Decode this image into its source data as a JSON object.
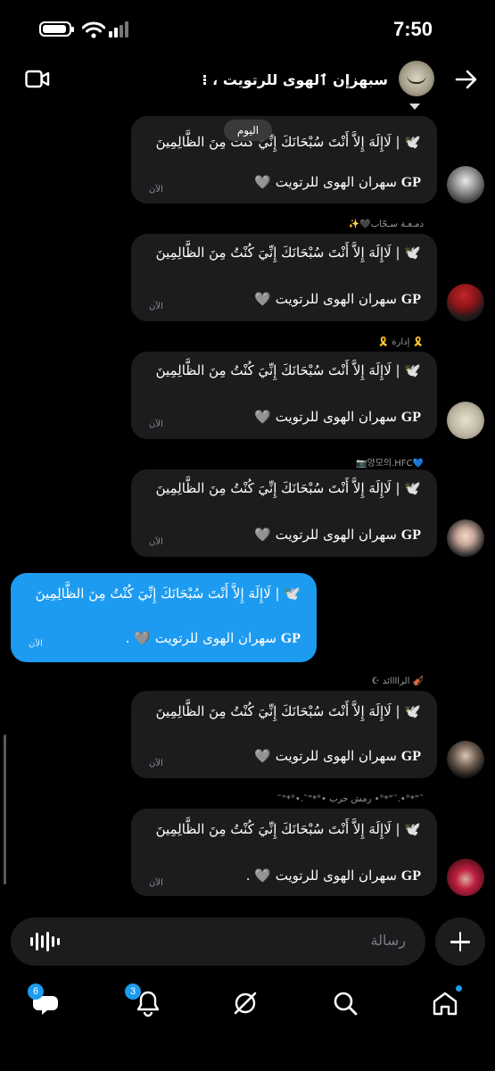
{
  "status_bar": {
    "time": "7:50"
  },
  "header": {
    "title": "سبهزإن ٱلهوى للرتويت ، ⁝",
    "date_pill": "اليوم"
  },
  "messages": [
    {
      "sender": "",
      "line1": "🕊️ | لَاإِلَهَ إِلاَّ أَنْتَ سُبْحَانَكَ إِنِّيَ كُنْتُ مِنَ الظَّالِمِينَ",
      "line2_gp": "GP",
      "line2_text": "سهران الهوى للرتويت 🩶",
      "time": "الآن"
    },
    {
      "sender": "دمـعـة سـحّاب🖤✨",
      "line1": "🕊️ | لَاإِلَهَ إِلاَّ أَنْتَ سُبْحَانَكَ إِنِّيَ كُنْتُ مِنَ الظَّالِمِينَ",
      "line2_gp": "GP",
      "line2_text": "سهران الهوى للرتويت 🩶",
      "time": "الآن"
    },
    {
      "sender": "🎗️ إدارة 🎗️",
      "line1": "🕊️ | لَاإِلَهَ إِلاَّ أَنْتَ سُبْحَانَكَ إِنِّيَ كُنْتُ مِنَ الظَّالِمِينَ",
      "line2_gp": "GP",
      "line2_text": "سهران الهوى للرتويت 🩶",
      "time": "الآن"
    },
    {
      "sender": "💙양모의.HFC📷",
      "line1": "🕊️ | لَاإِلَهَ إِلاَّ أَنْتَ سُبْحَانَكَ إِنِّيَ كُنْتُ مِنَ الظَّالِمِينَ",
      "line2_gp": "GP",
      "line2_text": "سهران الهوى للرتويت 🩶",
      "time": "الآن"
    },
    {
      "sender": "",
      "mine": true,
      "line1": "🕊️ | لَاإِلَهَ إِلاَّ أَنْتَ سُبْحَانَكَ إِنِّيَ كُنْتُ مِنَ الظَّالِمِينَ",
      "line2_gp": "GP",
      "line2_text": "سهران الهوى للرتويت 🩶 .",
      "time": "الآن"
    },
    {
      "sender": "🎻 الراااائد ☪︎",
      "line1": "🕊️ | لَاإِلَهَ إِلاَّ أَنْتَ سُبْحَانَكَ إِنِّيَ كُنْتُ مِنَ الظَّالِمِينَ",
      "line2_gp": "GP",
      "line2_text": "سهران الهوى للرتويت 🩶",
      "time": "الآن"
    },
    {
      "sender": "˜”*°•.˜”*°• رمش حرب •°*”˜.•°*”˜",
      "line1": "🕊️ | لَاإِلَهَ إِلاَّ أَنْتَ سُبْحَانَكَ إِنِّيَ كُنْتُ مِنَ الظَّالِمِينَ",
      "line2_gp": "GP",
      "line2_text": "سهران الهوى للرتويت 🩶 .",
      "time": "الآن"
    }
  ],
  "composer": {
    "placeholder": "رسالة"
  },
  "nav": {
    "messages_badge": "6",
    "notifications_badge": "3"
  },
  "colors": {
    "accent": "#1d9bf0",
    "bubble": "#1c1c1e",
    "background": "#000000"
  }
}
